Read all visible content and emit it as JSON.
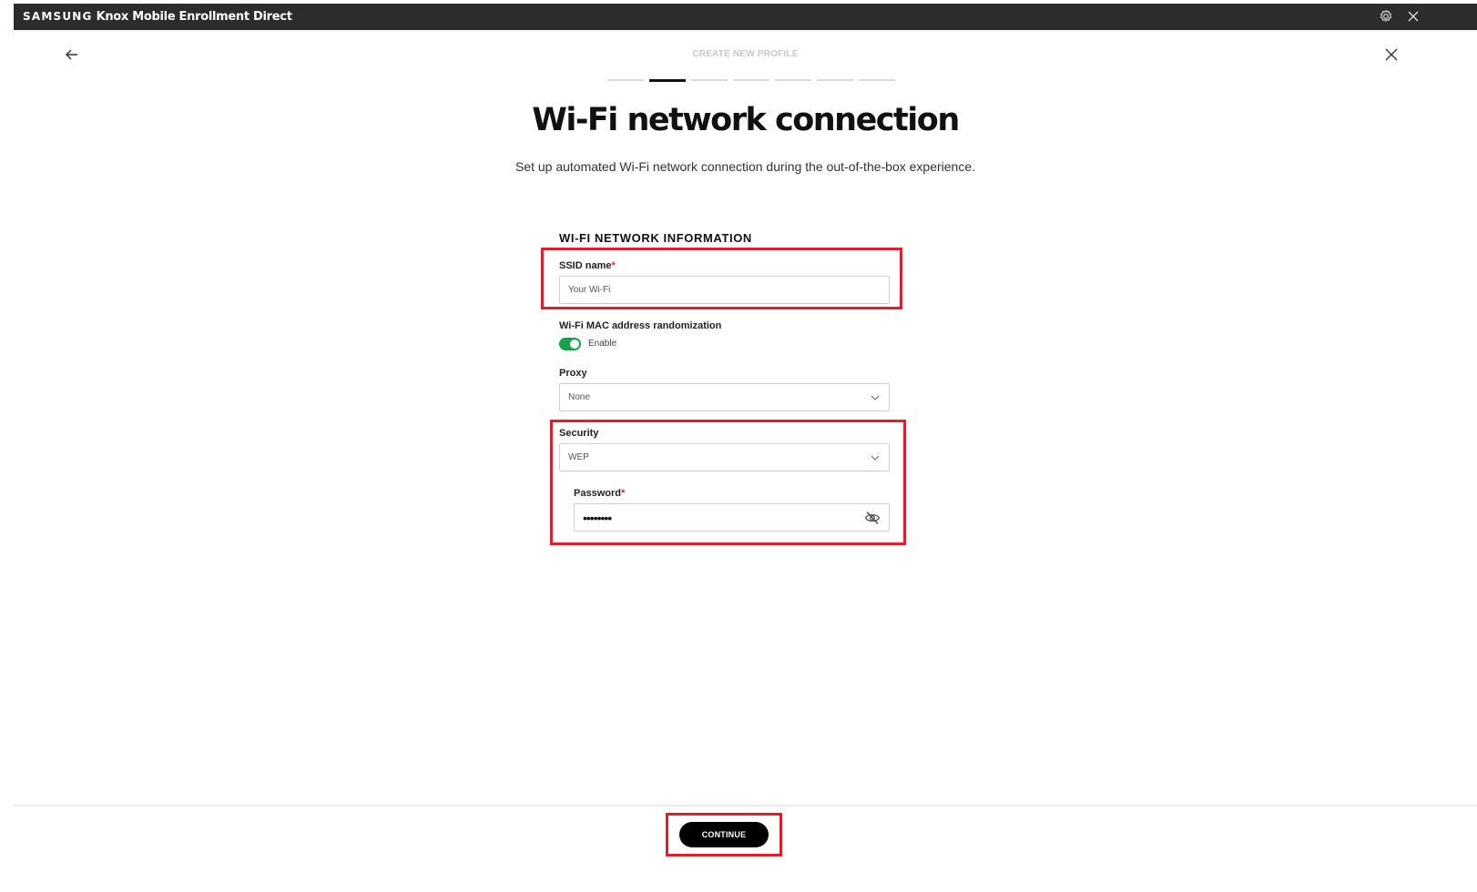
{
  "app": {
    "brand": "SAMSUNG",
    "title": "Knox Mobile Enrollment Direct",
    "settings_icon": "gear-icon",
    "close_icon": "close-icon"
  },
  "nav": {
    "back_icon": "arrow-left-icon",
    "close_icon": "close-icon",
    "step_title": "CREATE NEW PROFILE",
    "steps_total": 7,
    "active_step": 2
  },
  "page": {
    "title": "Wi-Fi network connection",
    "subtitle": "Set up automated Wi-Fi network connection during the out-of-the-box experience."
  },
  "form": {
    "section_heading": "WI-FI NETWORK INFORMATION",
    "ssid": {
      "label": "SSID name",
      "required_mark": "*",
      "value": "Your Wi-Fi"
    },
    "mac_randomization": {
      "label": "Wi-Fi MAC address randomization",
      "toggle_label": "Enable",
      "enabled": true
    },
    "proxy": {
      "label": "Proxy",
      "value": "None"
    },
    "security": {
      "label": "Security",
      "value": "WEP"
    },
    "password": {
      "label": "Password",
      "required_mark": "*",
      "value": "••••••••",
      "visibility_icon": "eye-off-icon"
    }
  },
  "footer": {
    "continue_label": "CONTINUE"
  },
  "colors": {
    "highlight": "#e01e2b",
    "toggle_on": "#17a34a",
    "titlebar": "#2b2c2e"
  }
}
